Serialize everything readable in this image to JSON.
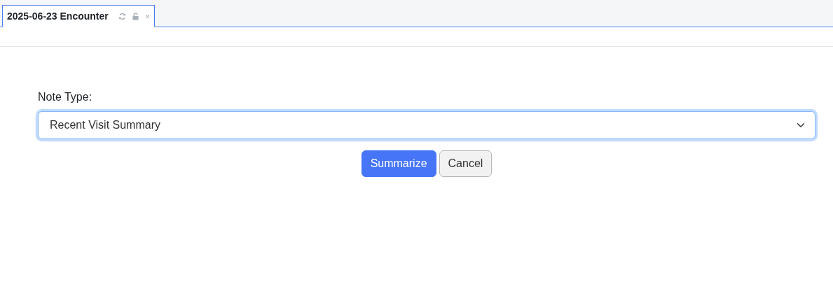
{
  "tabs": [
    {
      "label": "2025-06-23 Encounter",
      "selected": true,
      "close": "×"
    }
  ],
  "form": {
    "label": "Note Type:",
    "select": {
      "value": "Recent Visit Summary",
      "focused": true
    }
  },
  "buttons": [
    {
      "label": "Summarize",
      "kind": "primary"
    },
    {
      "label": "Cancel",
      "kind": "secondary"
    }
  ]
}
